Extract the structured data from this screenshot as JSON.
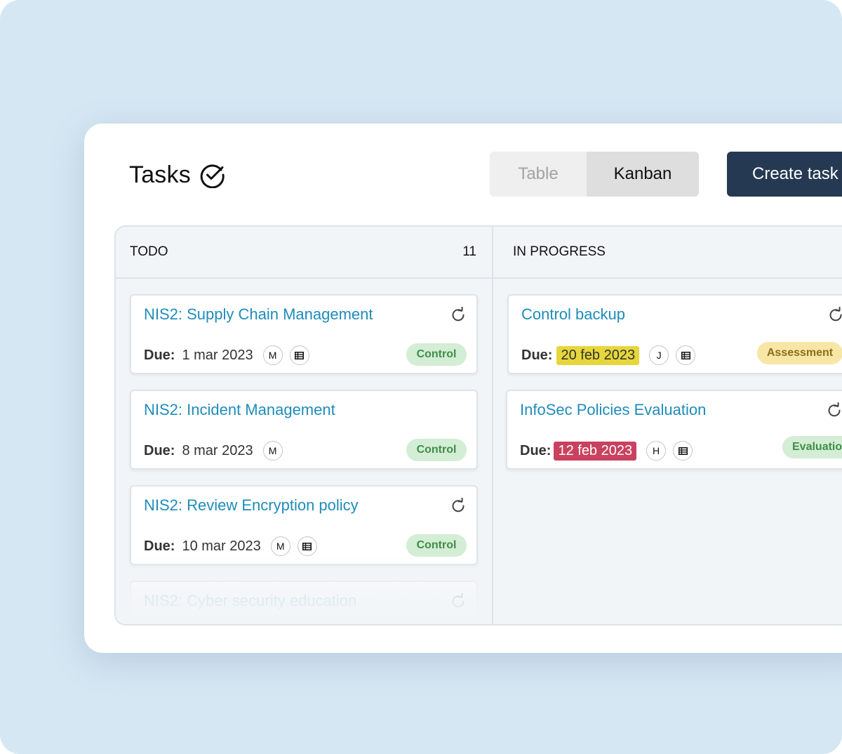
{
  "header": {
    "title": "Tasks",
    "title_icon": "check-circle-icon",
    "views": {
      "table_label": "Table",
      "kanban_label": "Kanban",
      "active": "Kanban"
    },
    "create_label": "Create task"
  },
  "columns": [
    {
      "name": "TODO",
      "count": "11",
      "cards": [
        {
          "title": "NIS2: Supply Chain Management",
          "due_label": "Due:",
          "due": "1 mar 2023",
          "due_state": "plain",
          "assignee": "M",
          "has_doc": true,
          "tag": "Control"
        },
        {
          "title": "NIS2: Incident Management",
          "due_label": "Due:",
          "due": "8 mar 2023",
          "due_state": "plain",
          "assignee": "M",
          "has_doc": false,
          "tag": "Control"
        },
        {
          "title": "NIS2: Review Encryption policy",
          "due_label": "Due:",
          "due": "10 mar 2023",
          "due_state": "plain",
          "assignee": "M",
          "has_doc": true,
          "tag": "Control"
        },
        {
          "title": "NIS2: Cyber security education"
        }
      ]
    },
    {
      "name": "IN PROGRESS",
      "count": "",
      "cards": [
        {
          "title": "Control backup",
          "due_label": "Due:",
          "due": "20 feb 2023",
          "due_state": "warn",
          "assignee": "J",
          "has_doc": true,
          "tag": "Assessment"
        },
        {
          "title": "InfoSec Policies Evaluation",
          "due_label": "Due:",
          "due": "12 feb 2023",
          "due_state": "overdue",
          "assignee": "H",
          "has_doc": true,
          "tag": "Evaluation"
        }
      ]
    }
  ],
  "colors": {
    "backdrop": "#d5e7f3",
    "primary_button": "#253a52",
    "link": "#1f8cba",
    "tag_control_bg": "#d4edd5",
    "tag_assessment_bg": "#f8e6a6",
    "due_warn": "#e6d63c",
    "due_overdue": "#c9415e"
  }
}
